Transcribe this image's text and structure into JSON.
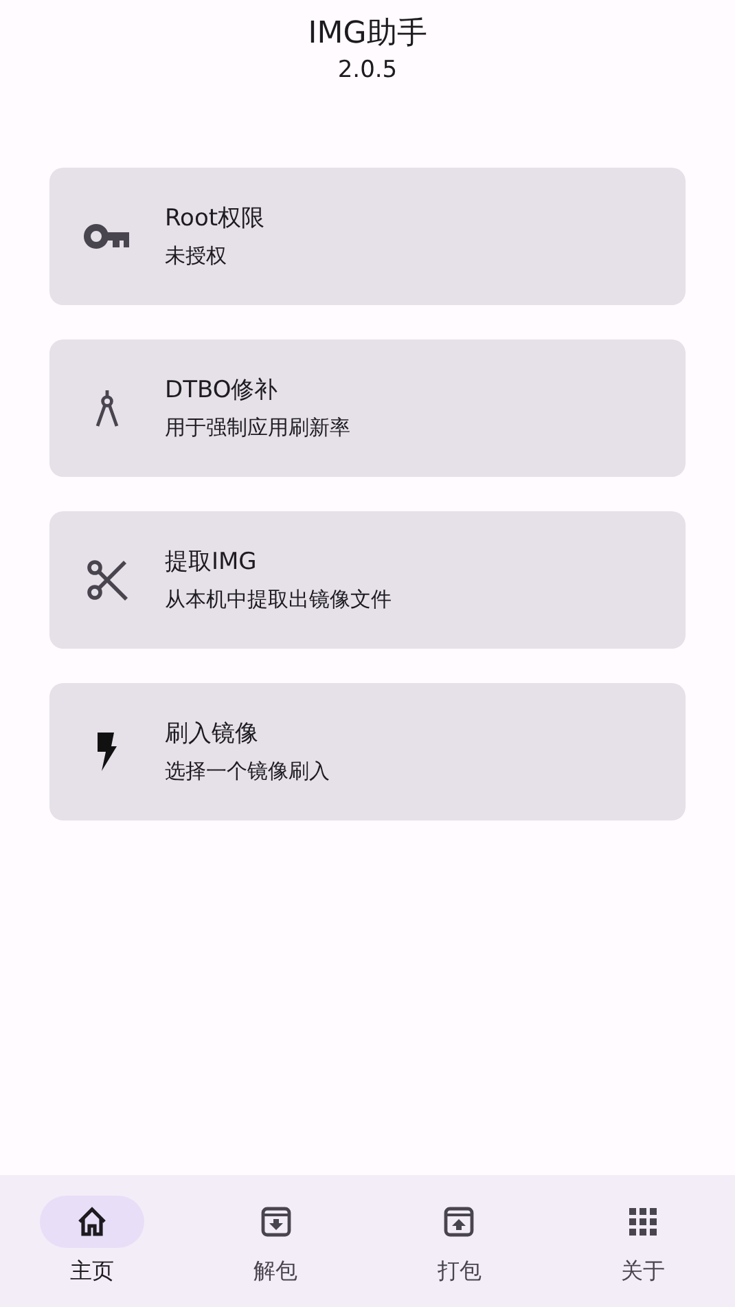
{
  "header": {
    "title": "IMG助手",
    "version": "2.0.5"
  },
  "cards": [
    {
      "kind": "key",
      "title": "Root权限",
      "subtitle": "未授权"
    },
    {
      "kind": "compass",
      "title": "DTBO修补",
      "subtitle": "用于强制应用刷新率"
    },
    {
      "kind": "scissors",
      "title": "提取IMG",
      "subtitle": "从本机中提取出镜像文件"
    },
    {
      "kind": "flash",
      "title": "刷入镜像",
      "subtitle": "选择一个镜像刷入"
    }
  ],
  "nav": [
    {
      "kind": "home",
      "label": "主页",
      "selected": true
    },
    {
      "kind": "unpack",
      "label": "解包",
      "selected": false
    },
    {
      "kind": "pack",
      "label": "打包",
      "selected": false
    },
    {
      "kind": "apps",
      "label": "关于",
      "selected": false
    }
  ]
}
